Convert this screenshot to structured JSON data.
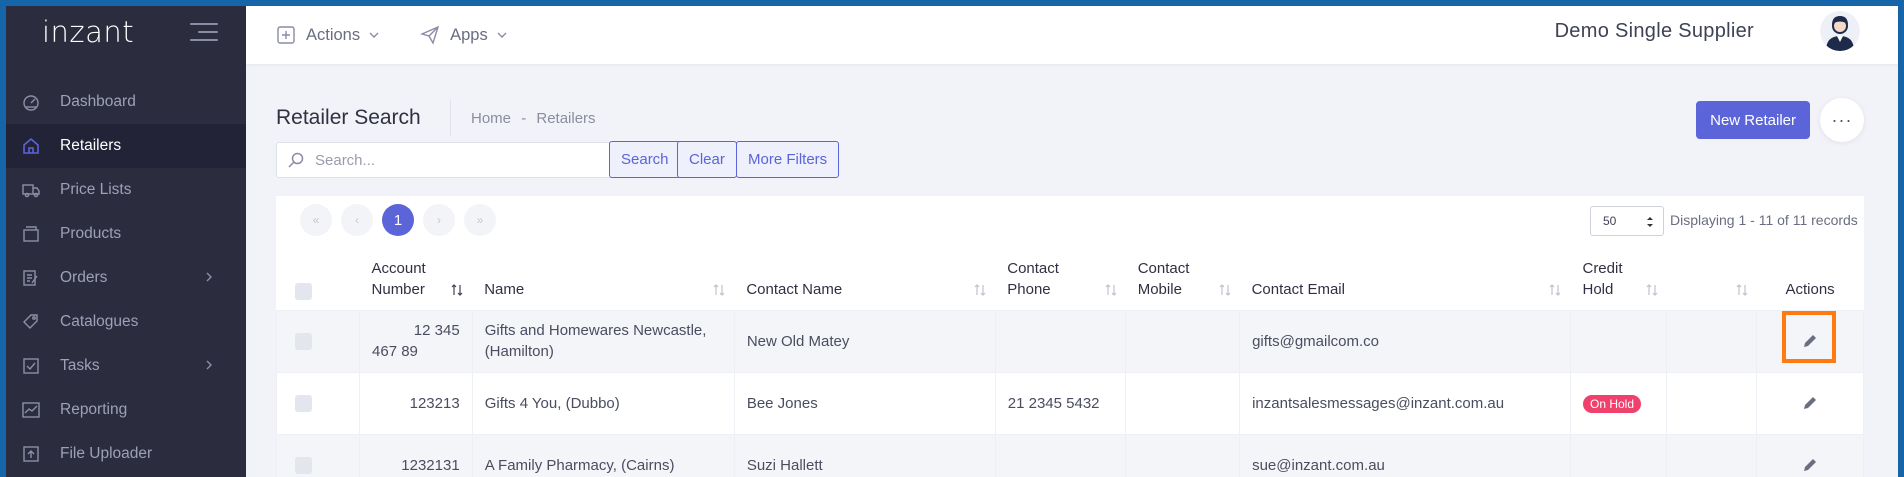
{
  "sidebar": {
    "brand": "inzant",
    "items": [
      {
        "label": "Dashboard",
        "icon": "dashboard-icon",
        "active": false,
        "chevron": false
      },
      {
        "label": "Retailers",
        "icon": "home-icon",
        "active": true,
        "chevron": false
      },
      {
        "label": "Price Lists",
        "icon": "truck-icon",
        "active": false,
        "chevron": false
      },
      {
        "label": "Products",
        "icon": "box-icon",
        "active": false,
        "chevron": false
      },
      {
        "label": "Orders",
        "icon": "edit-list-icon",
        "active": false,
        "chevron": true
      },
      {
        "label": "Catalogues",
        "icon": "tags-icon",
        "active": false,
        "chevron": false
      },
      {
        "label": "Tasks",
        "icon": "tasks-icon",
        "active": false,
        "chevron": true
      },
      {
        "label": "Reporting",
        "icon": "chart-icon",
        "active": false,
        "chevron": false
      },
      {
        "label": "File Uploader",
        "icon": "upload-icon",
        "active": false,
        "chevron": false
      }
    ]
  },
  "topbar": {
    "actions_label": "Actions",
    "apps_label": "Apps",
    "supplier_name": "Demo Single Supplier"
  },
  "page": {
    "title": "Retailer Search",
    "breadcrumb_home": "Home",
    "breadcrumb_sep": "-",
    "breadcrumb_current": "Retailers",
    "new_button": "New Retailer",
    "more_button": "···"
  },
  "search": {
    "placeholder": "Search...",
    "search_button": "Search",
    "clear_button": "Clear",
    "more_filters_button": "More Filters"
  },
  "pagination": {
    "current_page": "1",
    "first": "«",
    "prev": "‹",
    "next": "›",
    "last": "»",
    "page_size": "50",
    "records_text": "Displaying 1 - 11 of 11 records"
  },
  "table": {
    "headers": {
      "account_number_1": "Account",
      "account_number_2": "Number",
      "name": "Name",
      "contact_name": "Contact Name",
      "contact_phone_1": "Contact",
      "contact_phone_2": "Phone",
      "contact_mobile_1": "Contact",
      "contact_mobile_2": "Mobile",
      "contact_email": "Contact Email",
      "credit_hold_1": "Credit",
      "credit_hold_2": "Hold",
      "actions": "Actions"
    },
    "rows": [
      {
        "account_1": "12 345",
        "account_2": "467 89",
        "name_1": "Gifts and Homewares Newcastle,",
        "name_2": "(Hamilton)",
        "contact_name": "New Old Matey",
        "phone": "",
        "mobile": "",
        "email": "gifts@gmailcom.co",
        "credit_hold": ""
      },
      {
        "account_1": "123213",
        "account_2": "",
        "name_1": "Gifts 4 You, (Dubbo)",
        "name_2": "",
        "contact_name": "Bee Jones",
        "phone": "21 2345 5432",
        "mobile": "",
        "email": "inzantsalesmessages@inzant.com.au",
        "credit_hold": "On Hold"
      },
      {
        "account_1": "1232131",
        "account_2": "",
        "name_1": "A Family Pharmacy, (Cairns)",
        "name_2": "",
        "contact_name": "Suzi Hallett",
        "phone": "",
        "mobile": "",
        "email": "sue@inzant.com.au",
        "credit_hold": ""
      }
    ]
  },
  "colors": {
    "accent": "#5b64d9",
    "sidebar_bg": "#2b2c3e",
    "badge": "#f0416c",
    "highlight": "#ff7a10"
  }
}
